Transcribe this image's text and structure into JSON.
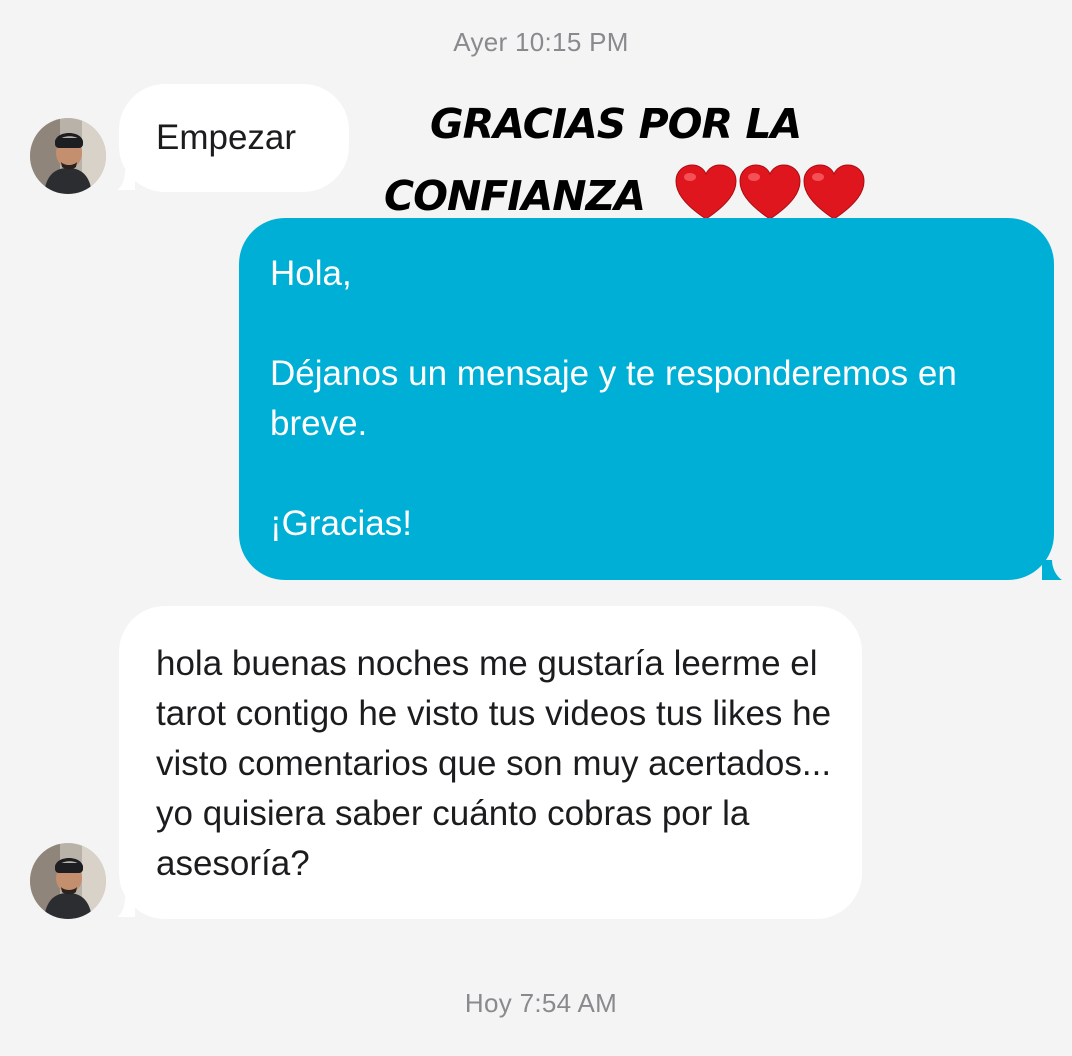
{
  "timestamps": {
    "top": "Ayer 10:15 PM",
    "bottom": "Hoy 7:54 AM"
  },
  "messages": {
    "first_incoming": "Empezar",
    "outgoing": {
      "greeting": "Hola,",
      "body": "Déjanos un mensaje y te responderemos en breve.",
      "closing": "¡Gracias!"
    },
    "second_incoming": "hola buenas noches me gustaría leerme el tarot contigo he visto tus videos tus likes he visto comentarios que son muy acertados... yo quisiera saber cuánto cobras por la asesoría?"
  },
  "overlay": {
    "line1": "GRACIAS POR LA",
    "line2": "CONFIANZA",
    "emoji": "heart-icon"
  },
  "colors": {
    "background": "#f4f4f4",
    "outgoing_bubble": "#00afd6",
    "incoming_bubble": "#ffffff",
    "timestamp_text": "#8a8a8e",
    "heart": "#e0161e"
  }
}
